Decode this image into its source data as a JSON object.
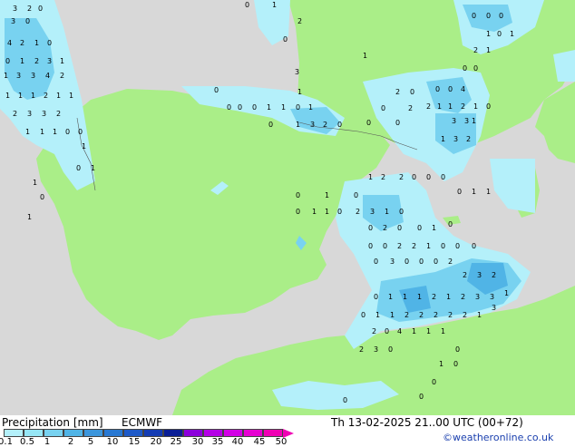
{
  "header": {
    "title": "Precipitation [mm]",
    "model": "ECMWF",
    "valid_time": "Th 13-02-2025 21..00 UTC (00+72)",
    "credit": "©weatheronline.co.uk"
  },
  "legend": {
    "ticks": [
      "0.1",
      "0.5",
      "1",
      "2",
      "5",
      "10",
      "15",
      "20",
      "25",
      "30",
      "35",
      "40",
      "45",
      "50"
    ],
    "colors": [
      "#b4f0fa",
      "#96e6f5",
      "#78d2f0",
      "#50b4e6",
      "#3c96dc",
      "#2878d2",
      "#1e5ac8",
      "#143cb4",
      "#0a1e96",
      "#8c00dc",
      "#b400e6",
      "#d200e6",
      "#e600d2",
      "#f000b4"
    ]
  },
  "map": {
    "sea_color": "#d8d8d8",
    "land_color": "#aaee88",
    "precip_labels": [
      {
        "t": "3"
      },
      {
        "t": "2"
      },
      {
        "t": "0"
      },
      {
        "t": "3"
      },
      {
        "t": "0"
      },
      {
        "t": "4"
      },
      {
        "t": "2"
      },
      {
        "t": "1"
      },
      {
        "t": "0"
      },
      {
        "t": "0"
      },
      {
        "t": "1"
      },
      {
        "t": "2"
      },
      {
        "t": "3"
      },
      {
        "t": "1"
      },
      {
        "t": "1"
      },
      {
        "t": "3"
      },
      {
        "t": "3"
      },
      {
        "t": "4"
      },
      {
        "t": "2"
      },
      {
        "t": "1"
      },
      {
        "t": "1"
      },
      {
        "t": "1"
      },
      {
        "t": "2"
      },
      {
        "t": "1"
      },
      {
        "t": "1"
      },
      {
        "t": "2"
      },
      {
        "t": "3"
      },
      {
        "t": "3"
      },
      {
        "t": "2"
      },
      {
        "t": "1"
      },
      {
        "t": "1"
      },
      {
        "t": "1"
      },
      {
        "t": "0"
      },
      {
        "t": "0"
      },
      {
        "t": "1"
      },
      {
        "t": "0"
      },
      {
        "t": "1"
      },
      {
        "t": "1"
      },
      {
        "t": "0"
      },
      {
        "t": "1"
      },
      {
        "t": "0"
      },
      {
        "t": "0"
      },
      {
        "t": "0"
      },
      {
        "t": "0"
      },
      {
        "t": "1"
      },
      {
        "t": "1"
      },
      {
        "t": "0"
      },
      {
        "t": "1"
      },
      {
        "t": "0"
      },
      {
        "t": "1"
      },
      {
        "t": "3"
      },
      {
        "t": "2"
      },
      {
        "t": "0"
      },
      {
        "t": "3"
      },
      {
        "t": "1"
      },
      {
        "t": "1"
      },
      {
        "t": "2"
      },
      {
        "t": "0"
      },
      {
        "t": "1"
      },
      {
        "t": "0"
      },
      {
        "t": "2"
      },
      {
        "t": "0"
      },
      {
        "t": "0"
      },
      {
        "t": "2"
      },
      {
        "t": "0"
      },
      {
        "t": "0"
      },
      {
        "t": "0"
      },
      {
        "t": "0"
      },
      {
        "t": "4"
      },
      {
        "t": "2"
      },
      {
        "t": "1"
      },
      {
        "t": "1"
      },
      {
        "t": "2"
      },
      {
        "t": "1"
      },
      {
        "t": "0"
      },
      {
        "t": "1"
      },
      {
        "t": "3"
      },
      {
        "t": "3"
      },
      {
        "t": "1"
      },
      {
        "t": "3"
      },
      {
        "t": "2"
      },
      {
        "t": "0"
      },
      {
        "t": "0"
      },
      {
        "t": "1"
      },
      {
        "t": "2"
      },
      {
        "t": "1"
      },
      {
        "t": "0"
      },
      {
        "t": "1"
      },
      {
        "t": "0"
      },
      {
        "t": "0"
      },
      {
        "t": "0"
      },
      {
        "t": "0"
      },
      {
        "t": "1"
      },
      {
        "t": "0"
      },
      {
        "t": "1"
      },
      {
        "t": "2"
      },
      {
        "t": "2"
      },
      {
        "t": "0"
      },
      {
        "t": "0"
      },
      {
        "t": "0"
      },
      {
        "t": "0"
      },
      {
        "t": "1"
      },
      {
        "t": "1"
      },
      {
        "t": "0"
      },
      {
        "t": "1"
      },
      {
        "t": "1"
      },
      {
        "t": "0"
      },
      {
        "t": "2"
      },
      {
        "t": "3"
      },
      {
        "t": "1"
      },
      {
        "t": "0"
      },
      {
        "t": "0"
      },
      {
        "t": "2"
      },
      {
        "t": "0"
      },
      {
        "t": "0"
      },
      {
        "t": "1"
      },
      {
        "t": "0"
      },
      {
        "t": "0"
      },
      {
        "t": "0"
      },
      {
        "t": "2"
      },
      {
        "t": "2"
      },
      {
        "t": "1"
      },
      {
        "t": "0"
      },
      {
        "t": "0"
      },
      {
        "t": "0"
      },
      {
        "t": "0"
      },
      {
        "t": "3"
      },
      {
        "t": "0"
      },
      {
        "t": "0"
      },
      {
        "t": "0"
      },
      {
        "t": "2"
      },
      {
        "t": "2"
      },
      {
        "t": "3"
      },
      {
        "t": "2"
      },
      {
        "t": "0"
      },
      {
        "t": "1"
      },
      {
        "t": "1"
      },
      {
        "t": "1"
      },
      {
        "t": "2"
      },
      {
        "t": "1"
      },
      {
        "t": "2"
      },
      {
        "t": "3"
      },
      {
        "t": "3"
      },
      {
        "t": "1"
      },
      {
        "t": "0"
      },
      {
        "t": "1"
      },
      {
        "t": "1"
      },
      {
        "t": "2"
      },
      {
        "t": "2"
      },
      {
        "t": "2"
      },
      {
        "t": "2"
      },
      {
        "t": "2"
      },
      {
        "t": "1"
      },
      {
        "t": "3"
      },
      {
        "t": "2"
      },
      {
        "t": "0"
      },
      {
        "t": "4"
      },
      {
        "t": "1"
      },
      {
        "t": "1"
      },
      {
        "t": "1"
      },
      {
        "t": "2"
      },
      {
        "t": "3"
      },
      {
        "t": "0"
      },
      {
        "t": "0"
      },
      {
        "t": "1"
      },
      {
        "t": "0"
      },
      {
        "t": "0"
      },
      {
        "t": "0"
      },
      {
        "t": "0"
      }
    ]
  }
}
